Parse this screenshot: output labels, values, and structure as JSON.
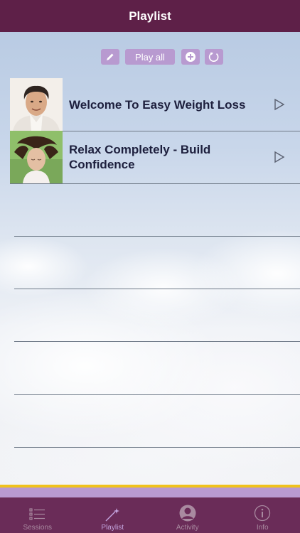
{
  "header": {
    "title": "Playlist"
  },
  "toolbar": {
    "edit_icon": "pencil-icon",
    "play_all_label": "Play all",
    "add_icon": "plus-circle-icon",
    "refresh_icon": "refresh-icon"
  },
  "playlist": [
    {
      "title": "Welcome To Easy Weight Loss",
      "thumbnail": "man-portrait"
    },
    {
      "title": "Relax Completely - Build Confidence",
      "thumbnail": "woman-relaxing"
    }
  ],
  "tabbar": {
    "tabs": [
      {
        "label": "Sessions",
        "icon": "list-icon",
        "active": false
      },
      {
        "label": "Playlist",
        "icon": "magic-wand-icon",
        "active": true
      },
      {
        "label": "Activity",
        "icon": "person-icon",
        "active": false
      },
      {
        "label": "Info",
        "icon": "info-icon",
        "active": false
      }
    ]
  },
  "colors": {
    "header_bg": "#5e2048",
    "button_bg": "#b89ad0",
    "accent_yellow": "#f0c21c",
    "tabbar_bg": "#6a2c58"
  }
}
